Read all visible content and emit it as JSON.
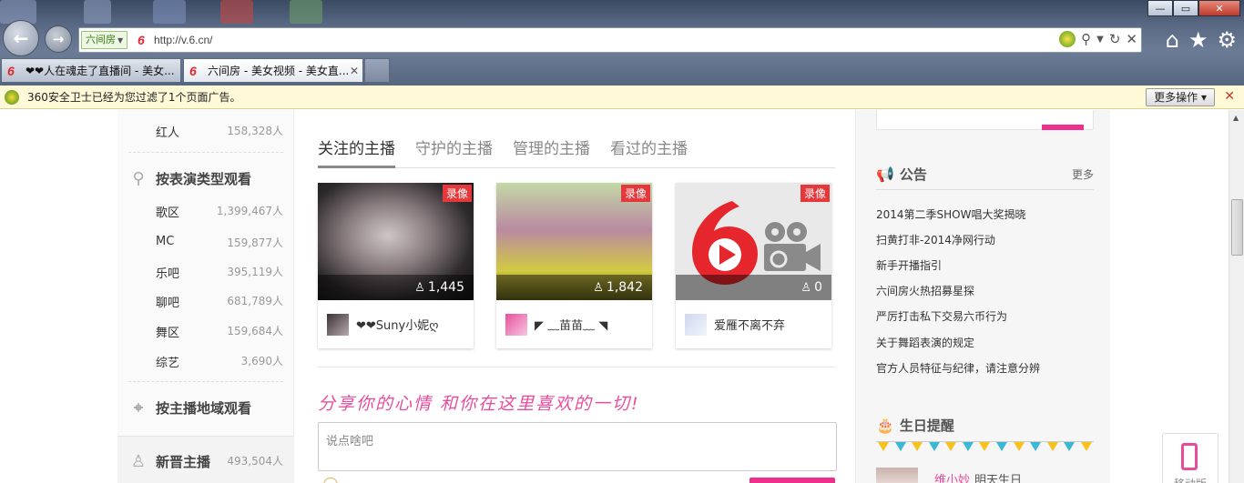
{
  "browser": {
    "site_badge": "六间房",
    "url": "http://v.6.cn/",
    "tabs": [
      {
        "title": "❤❤人在魂走了直播间 - 美女..."
      },
      {
        "title": "六间房 - 美女视频 - 美女直..."
      }
    ],
    "window_controls": {
      "minimize": "—",
      "maximize": "▭",
      "close": "✕"
    }
  },
  "notification": {
    "text": "360安全卫士已经为您过滤了1个页面广告。",
    "more_ops": "更多操作 ▾"
  },
  "sidebar": {
    "top_category": {
      "name": "红人",
      "count": "158,328人"
    },
    "by_type": {
      "title": "按表演类型观看",
      "items": [
        {
          "name": "歌区",
          "count": "1,399,467人"
        },
        {
          "name": "MC",
          "count": "159,877人"
        },
        {
          "name": "乐吧",
          "count": "395,119人"
        },
        {
          "name": "聊吧",
          "count": "681,789人"
        },
        {
          "name": "舞区",
          "count": "159,684人"
        },
        {
          "name": "综艺",
          "count": "3,690人"
        }
      ]
    },
    "by_region": {
      "title": "按主播地域观看"
    },
    "new_hosts": {
      "title": "新晋主播",
      "count": "493,504人"
    }
  },
  "main": {
    "tabs": [
      {
        "label": "关注的主播"
      },
      {
        "label": "守护的主播"
      },
      {
        "label": "管理的主播"
      },
      {
        "label": "看过的主播"
      }
    ],
    "cards": [
      {
        "badge": "录像",
        "viewers": "1,445",
        "name": "❤❤Suny小妮ღ"
      },
      {
        "badge": "录像",
        "viewers": "1,842",
        "name": "◤ ﹏苗苗﹏ ◥"
      },
      {
        "badge": "录像",
        "viewers": "0",
        "name": "爱雁不离不弃"
      }
    ],
    "share_title": "分享你的心情 和你在这里喜欢的一切!",
    "share_placeholder": "说点啥吧"
  },
  "right": {
    "notice": {
      "title": "公告",
      "more": "更多",
      "items": [
        "2014第二季SHOW唱大奖揭晓",
        "扫黄打非-2014净网行动",
        "新手开播指引",
        "六间房火热招募星探",
        "严厉打击私下交易六币行为",
        "关于舞蹈表演的规定",
        "官方人员特征与纪律，请注意分辨"
      ]
    },
    "birthday": {
      "title": "生日提醒",
      "name": "维小妙",
      "text": "明天生日"
    }
  },
  "mobile_float": {
    "label": "移动版"
  },
  "colors": {
    "accent_pink": "#ef2f8c",
    "record_red": "#e5383b",
    "logo_red": "#e5262c"
  }
}
